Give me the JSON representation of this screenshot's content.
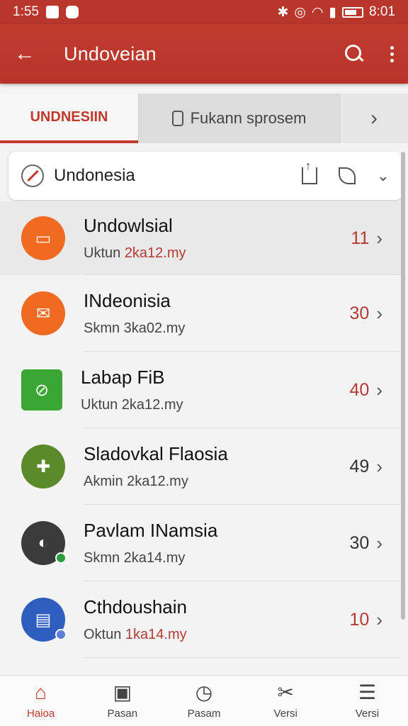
{
  "status": {
    "time": "1:55",
    "clock": "8:01"
  },
  "app_bar": {
    "title": "Undoveian",
    "back_glyph": "←"
  },
  "tabs": [
    {
      "label": "UNDNESIIN"
    },
    {
      "label": "Fukann sprosem"
    },
    {
      "label": "›"
    }
  ],
  "section": {
    "title": "Undonesia",
    "chevron": "⌄"
  },
  "list": [
    {
      "name": "Undowlsial",
      "sub_prefix": "Uktun ",
      "sub_hl": "2ka12.my",
      "sub_rest": "",
      "count": "11",
      "count_color": "#b53a33",
      "avatar_color": "#f06a22",
      "avatar_glyph": "▭",
      "icon": "card-icon"
    },
    {
      "name": "INdeonisia",
      "sub_prefix": "Skmn 3ka02.my",
      "sub_hl": "",
      "sub_rest": "",
      "count": "30",
      "count_color": "#b53a33",
      "avatar_color": "#f06a22",
      "avatar_glyph": "✉",
      "icon": "mail-icon"
    },
    {
      "name": "Labap FiB",
      "sub_prefix": "Uktun 2ka12.my",
      "sub_hl": "",
      "sub_rest": "",
      "count": "40",
      "count_color": "#b53a33",
      "avatar_color": "#3aa634",
      "avatar_glyph": "⊘",
      "icon": "block-icon"
    },
    {
      "name": "Sladovkal Flaosia",
      "sub_prefix": "Akmin 2ka12.my",
      "sub_hl": "",
      "sub_rest": "",
      "count": "49",
      "count_color": "#333333",
      "avatar_color": "#5a8a2a",
      "avatar_glyph": "✚",
      "icon": "plant-icon"
    },
    {
      "name": "Pavlam INamsia",
      "sub_prefix": "Skmn 2ka14.my",
      "sub_hl": "",
      "sub_rest": "",
      "count": "30",
      "count_color": "#333333",
      "avatar_color": "#3b3b3b",
      "avatar_glyph": "◐",
      "icon": "photo-avatar"
    },
    {
      "name": "Cthdoushain",
      "sub_prefix": "Oktun ",
      "sub_hl": "1ka14.my",
      "sub_rest": "",
      "count": "10",
      "count_color": "#b53a33",
      "avatar_color": "#2f5dbf",
      "avatar_glyph": "▤",
      "icon": "doc-icon"
    }
  ],
  "bottom_nav": [
    {
      "label": "Haioa",
      "glyph": "⌂",
      "icon": "home-icon"
    },
    {
      "label": "Pasan",
      "glyph": "▣",
      "icon": "calendar-icon"
    },
    {
      "label": "Pasam",
      "glyph": "◷",
      "icon": "clock-icon"
    },
    {
      "label": "Versi",
      "glyph": "✂",
      "icon": "scissors-icon"
    },
    {
      "label": "Versi",
      "glyph": "☰",
      "icon": "menu-icon"
    }
  ],
  "colors": {
    "primary": "#c0392b",
    "accent_text": "#b53a33"
  }
}
